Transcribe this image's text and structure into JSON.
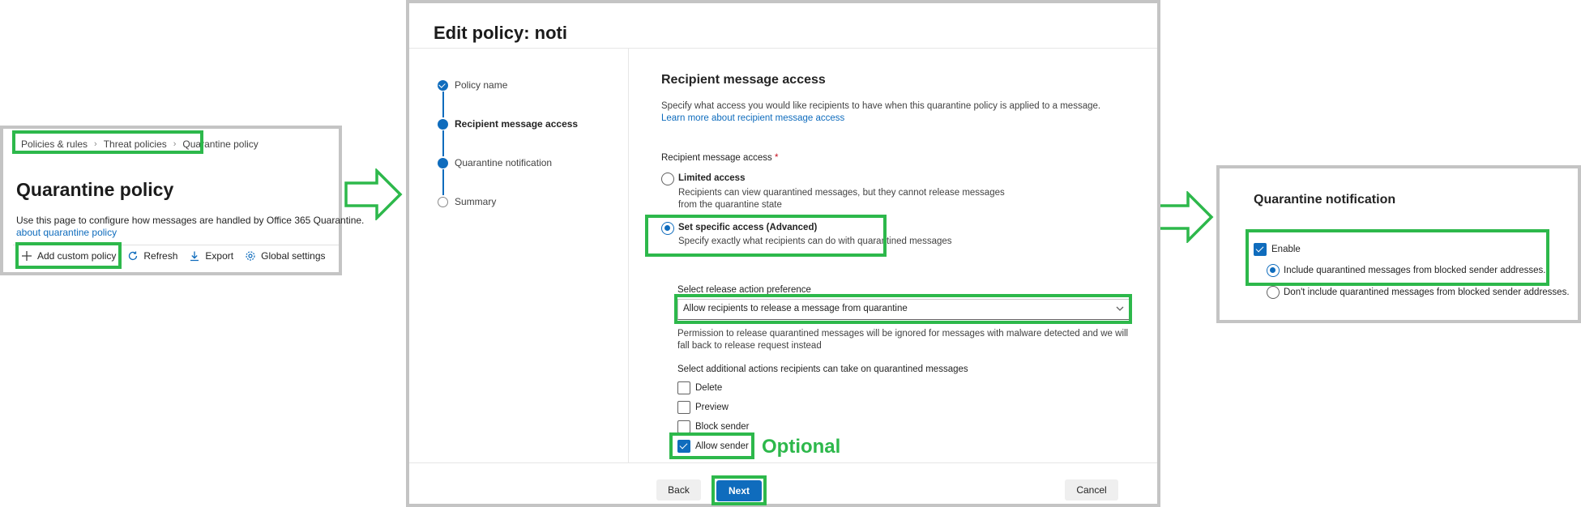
{
  "panel1": {
    "breadcrumb": [
      "Policies & rules",
      "Threat policies",
      "Quarantine policy"
    ],
    "title": "Quarantine policy",
    "description": "Use this page to configure how messages are handled by Office 365 Quarantine.",
    "link": "about quarantine policy",
    "toolbar": {
      "add": "Add custom policy",
      "refresh": "Refresh",
      "export": "Export",
      "global": "Global settings"
    }
  },
  "panel2": {
    "title": "Edit policy: noti",
    "steps": [
      {
        "label": "Policy name",
        "state": "done"
      },
      {
        "label": "Recipient message access",
        "state": "current"
      },
      {
        "label": "Quarantine notification",
        "state": "current"
      },
      {
        "label": "Summary",
        "state": "todo"
      }
    ],
    "section_title": "Recipient message access",
    "section_desc": "Specify what access you would like recipients to have when this quarantine policy is applied to a message.",
    "section_link": "Learn more about recipient message access",
    "field_label": "Recipient message access",
    "required_mark": "*",
    "options": [
      {
        "title": "Limited access",
        "desc": "Recipients can view quarantined messages, but they cannot release messages from the quarantine state",
        "selected": false
      },
      {
        "title": "Set specific access (Advanced)",
        "desc": "Specify exactly what recipients can do with quarantined messages",
        "selected": true
      }
    ],
    "release_label": "Select release action preference",
    "release_value": "Allow recipients to release a message from quarantine",
    "release_help": "Permission to release quarantined messages will be ignored for messages with malware detected and we will fall back to release request instead",
    "actions_label": "Select additional actions recipients can take on quarantined messages",
    "actions": [
      {
        "label": "Delete",
        "checked": false
      },
      {
        "label": "Preview",
        "checked": false
      },
      {
        "label": "Block sender",
        "checked": false
      },
      {
        "label": "Allow sender",
        "checked": true
      }
    ],
    "optional_note": "Optional",
    "buttons": {
      "back": "Back",
      "next": "Next",
      "cancel": "Cancel"
    }
  },
  "panel3": {
    "title": "Quarantine notification",
    "enable_label": "Enable",
    "enable_checked": true,
    "options": [
      {
        "label": "Include quarantined messages from blocked sender addresses.",
        "selected": true
      },
      {
        "label": "Don't include quarantined messages from blocked sender addresses.",
        "selected": false
      }
    ]
  },
  "colors": {
    "highlight": "#2db84b",
    "accent": "#0f6cbd",
    "panel_border": "#c4c4c4"
  }
}
